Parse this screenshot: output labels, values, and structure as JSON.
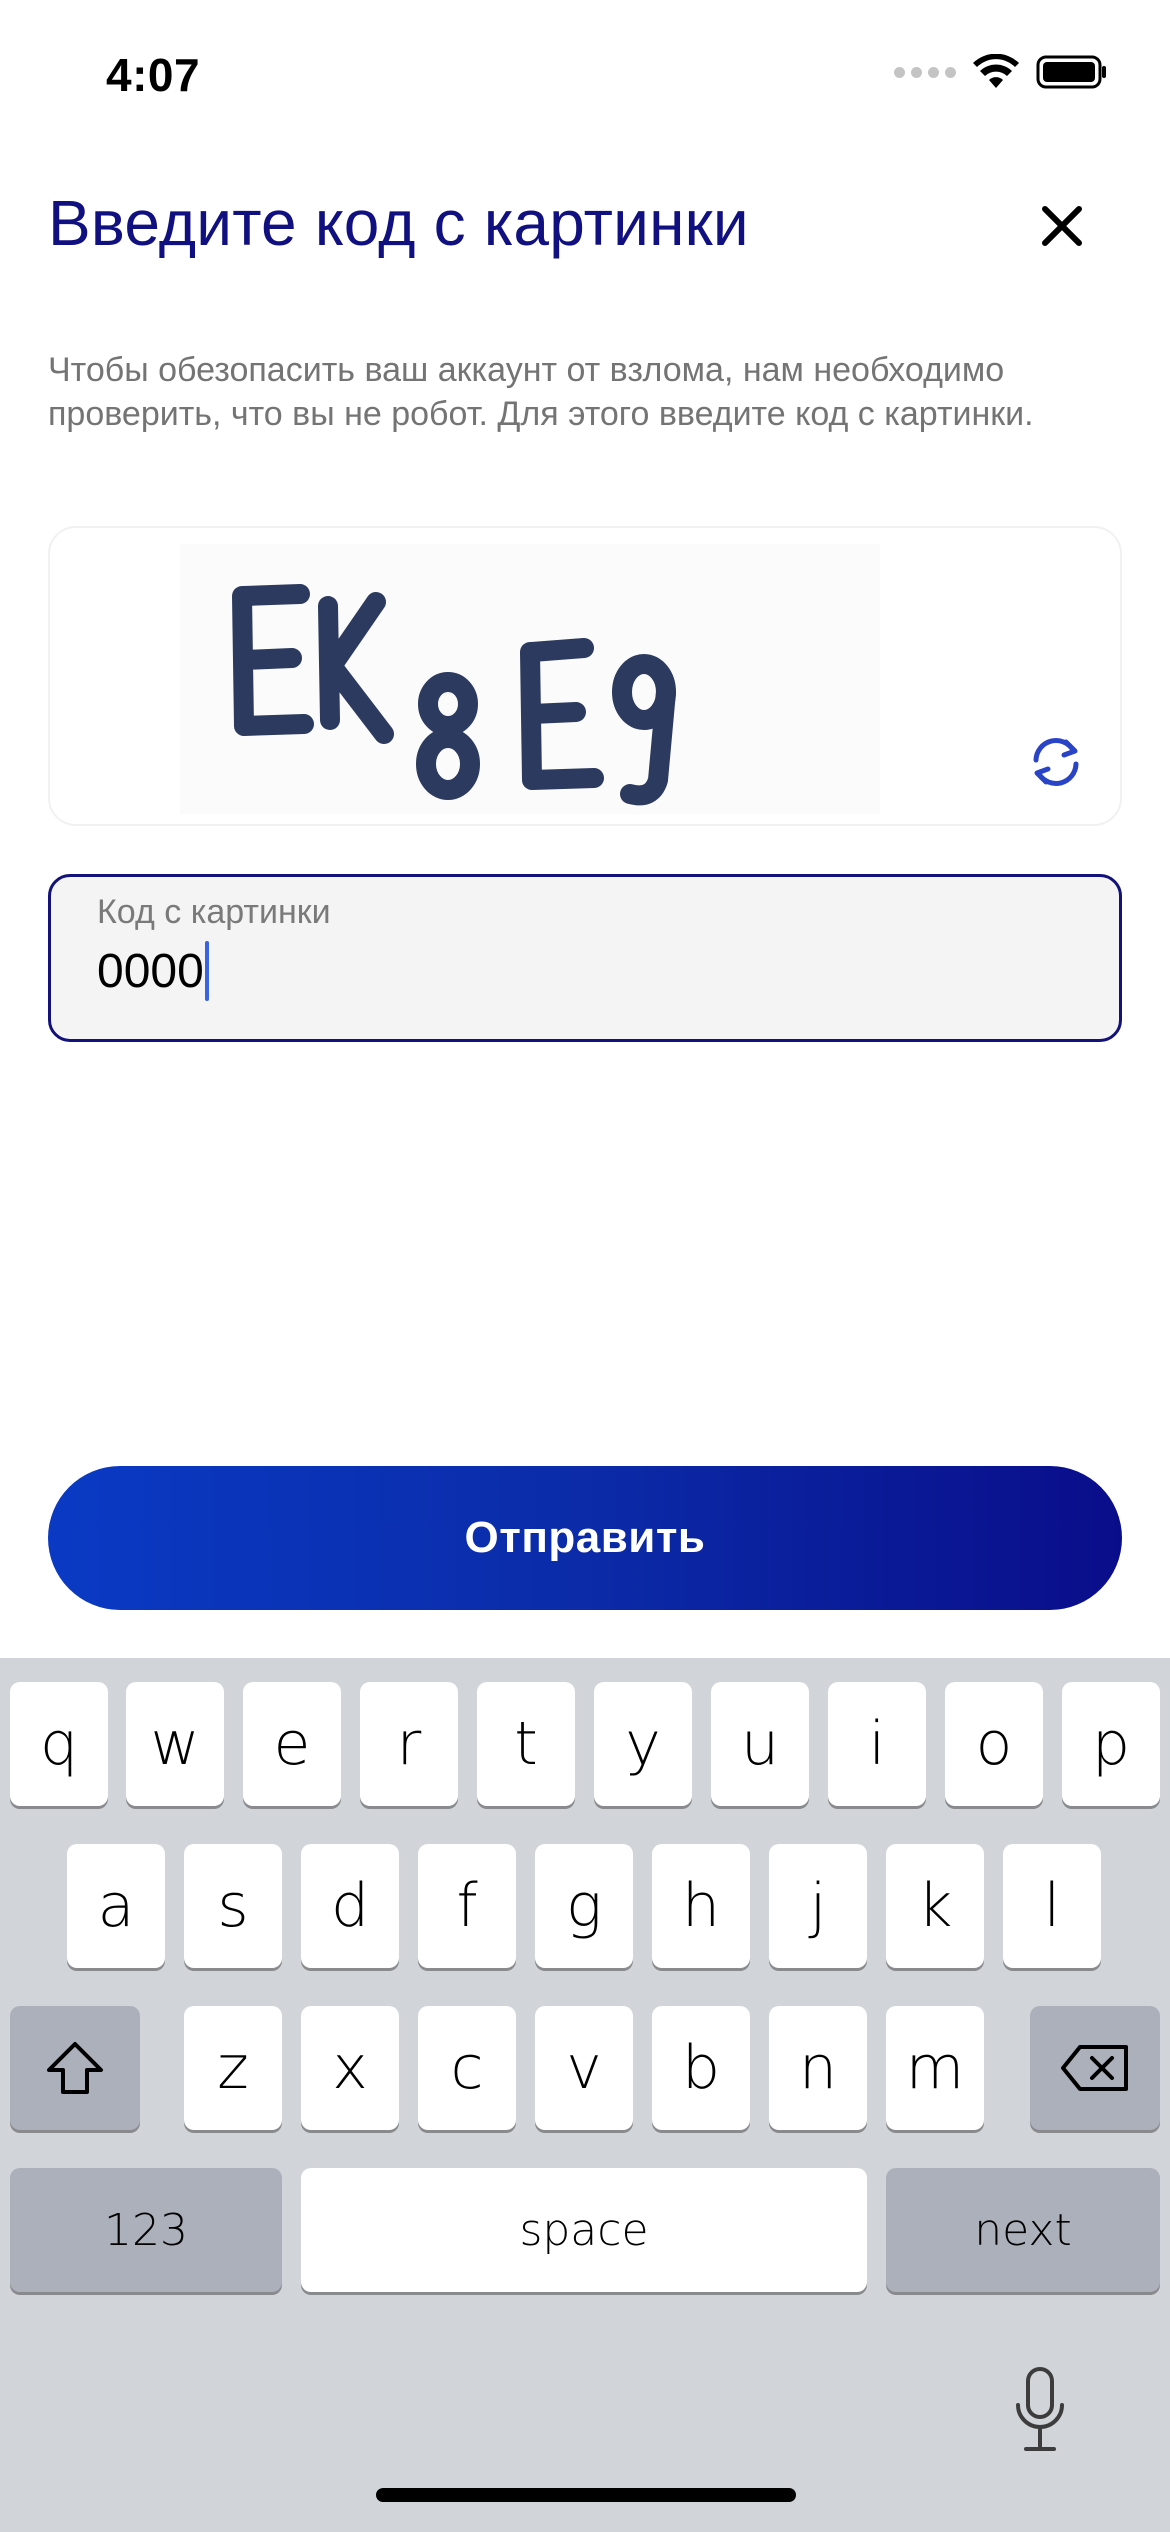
{
  "status_bar": {
    "time": "4:07"
  },
  "header": {
    "title": "Введите код с картинки"
  },
  "description": "Чтобы обезопасить ваш аккаунт от взлома, нам необходимо проверить, что вы не робот. Для этого введите код с картинки.",
  "captcha": {
    "text": "EK8E9"
  },
  "input": {
    "label": "Код с картинки",
    "value": "0000"
  },
  "submit": {
    "label": "Отправить"
  },
  "keyboard": {
    "row1": [
      "q",
      "w",
      "e",
      "r",
      "t",
      "y",
      "u",
      "i",
      "o",
      "p"
    ],
    "row2": [
      "a",
      "s",
      "d",
      "f",
      "g",
      "h",
      "j",
      "k",
      "l"
    ],
    "row3": [
      "z",
      "x",
      "c",
      "v",
      "b",
      "n",
      "m"
    ],
    "numbers_label": "123",
    "space_label": "space",
    "next_label": "next"
  },
  "colors": {
    "accent": "#111080",
    "button_start": "#0a3ac4",
    "button_end": "#0a0d8a",
    "caret": "#3a63e4"
  }
}
